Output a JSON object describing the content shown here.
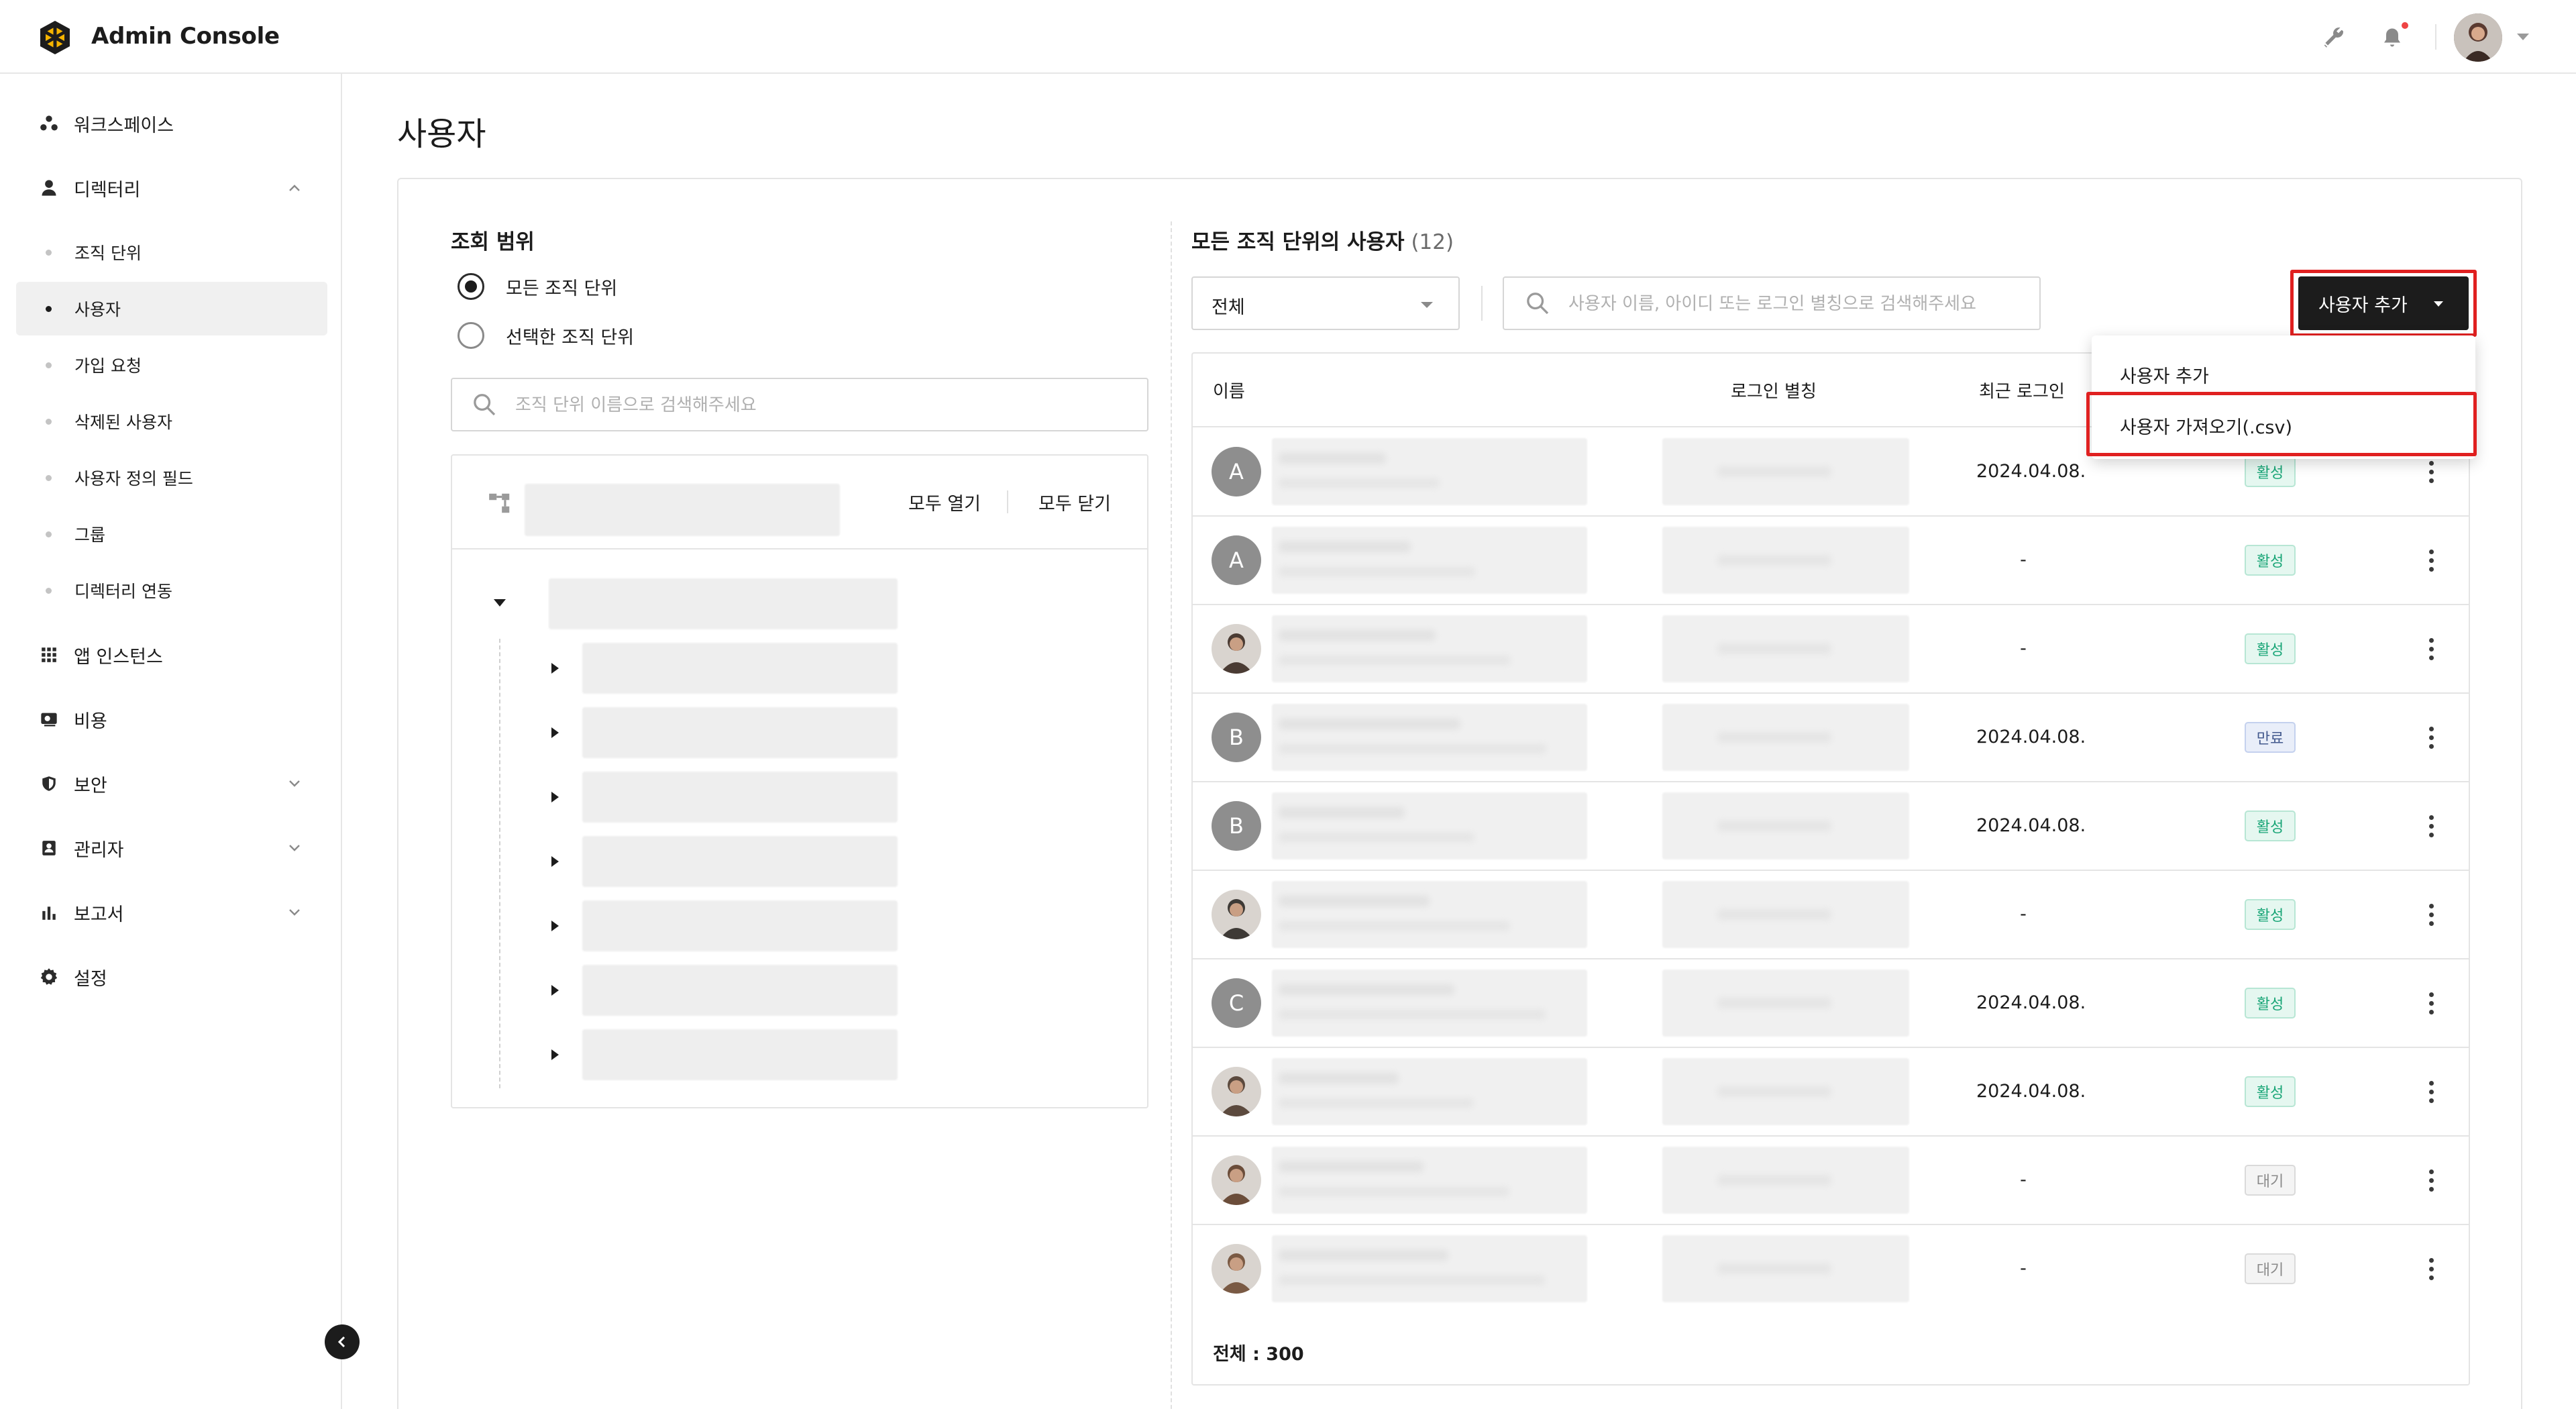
{
  "app": {
    "title": "Admin Console"
  },
  "header": {
    "icons": [
      "wrench-icon",
      "bell-icon",
      "avatar",
      "chevron-down-icon"
    ],
    "notification_dot_color": "#ee4444"
  },
  "sidebar": {
    "items": [
      {
        "label": "워크스페이스",
        "icon": "workspace-icon"
      },
      {
        "label": "디렉터리",
        "icon": "person-icon",
        "expanded": true
      },
      {
        "label": "앱 인스턴스",
        "icon": "grid-icon"
      },
      {
        "label": "비용",
        "icon": "billing-icon"
      },
      {
        "label": "보안",
        "icon": "shield-icon",
        "expanded": false
      },
      {
        "label": "관리자",
        "icon": "admin-badge-icon",
        "expanded": false
      },
      {
        "label": "보고서",
        "icon": "bar-chart-icon",
        "expanded": false
      },
      {
        "label": "설정",
        "icon": "gear-icon"
      }
    ],
    "directory_sub": [
      "조직 단위",
      "사용자",
      "가입 요청",
      "삭제된 사용자",
      "사용자 정의 필드",
      "그룹",
      "디렉터리 연동"
    ],
    "active_sub": "사용자"
  },
  "page": {
    "title": "사용자"
  },
  "scope": {
    "title": "조회 범위",
    "options": [
      "모든 조직 단위",
      "선택한 조직 단위"
    ],
    "selected": "모든 조직 단위",
    "search_placeholder": "조직 단위 이름으로 검색해주세요",
    "expand_all": "모두 열기",
    "collapse_all": "모두 닫기"
  },
  "users": {
    "title": "모든 조직 단위의 사용자",
    "count": "(12)",
    "filter_value": "전체",
    "search_placeholder": "사용자 이름, 아이디 또는 로그인 별칭으로 검색해주세요",
    "add_button": "사용자 추가",
    "columns": [
      "이름",
      "로그인 별칭",
      "최근 로그인"
    ],
    "rows": [
      {
        "avatar": "A",
        "last_login": "2024.04.08.",
        "status": "활성",
        "status_type": "active"
      },
      {
        "avatar": "A",
        "last_login": "-",
        "status": "활성",
        "status_type": "active"
      },
      {
        "avatar": "photo",
        "last_login": "-",
        "status": "활성",
        "status_type": "active"
      },
      {
        "avatar": "B",
        "last_login": "2024.04.08.",
        "status": "만료",
        "status_type": "expired"
      },
      {
        "avatar": "B",
        "last_login": "2024.04.08.",
        "status": "활성",
        "status_type": "active"
      },
      {
        "avatar": "photo",
        "last_login": "-",
        "status": "활성",
        "status_type": "active"
      },
      {
        "avatar": "C",
        "last_login": "2024.04.08.",
        "status": "활성",
        "status_type": "active"
      },
      {
        "avatar": "photo",
        "last_login": "2024.04.08.",
        "status": "활성",
        "status_type": "active"
      },
      {
        "avatar": "photo",
        "last_login": "-",
        "status": "대기",
        "status_type": "pending"
      },
      {
        "avatar": "photo",
        "last_login": "-",
        "status": "대기",
        "status_type": "pending"
      }
    ],
    "total": "전체 : 300"
  },
  "dropdown": {
    "items": [
      "사용자 추가",
      "사용자 가져오기(.csv)"
    ]
  },
  "colors": {
    "accent_dark": "#1c1c1c",
    "highlight": "#e02020",
    "active_badge": "#18a576"
  }
}
